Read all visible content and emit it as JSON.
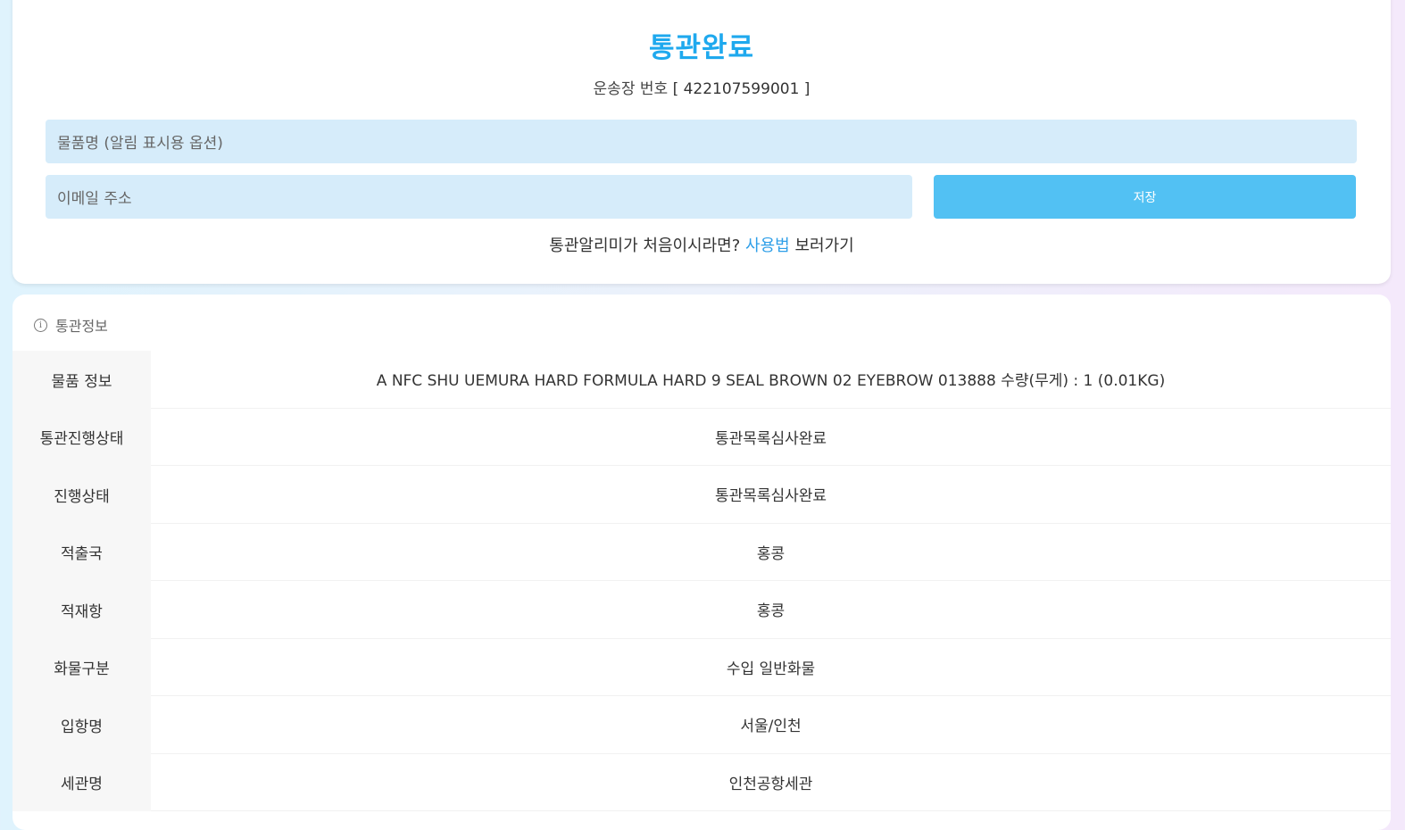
{
  "header": {
    "title": "통관완료",
    "tracking_label": "운송장 번호",
    "tracking_number": "[ 422107599001 ]"
  },
  "form": {
    "item_placeholder": "물품명 (알림 표시용 옵션)",
    "email_placeholder": "이메일 주소",
    "save_label": "저장"
  },
  "guide": {
    "prefix": "통관알리미가 처음이시라면?",
    "link": "사용법",
    "suffix": "보러가기"
  },
  "info": {
    "title": "통관정보",
    "rows": [
      {
        "label": "물품 정보",
        "value": "A NFC SHU UEMURA HARD FORMULA HARD 9 SEAL BROWN 02 EYEBROW 013888 수량(무게) : 1 (0.01KG)"
      },
      {
        "label": "통관진행상태",
        "value": "통관목록심사완료"
      },
      {
        "label": "진행상태",
        "value": "통관목록심사완료"
      },
      {
        "label": "적출국",
        "value": "홍콩"
      },
      {
        "label": "적재항",
        "value": "홍콩"
      },
      {
        "label": "화물구분",
        "value": "수입 일반화물"
      },
      {
        "label": "입항명",
        "value": "서울/인천"
      },
      {
        "label": "세관명",
        "value": "인천공항세관"
      }
    ]
  },
  "colors": {
    "accent": "#1fa9ee",
    "button": "#52c1f3",
    "input_bg": "#d6ecfa",
    "link": "#2f9fe8"
  }
}
